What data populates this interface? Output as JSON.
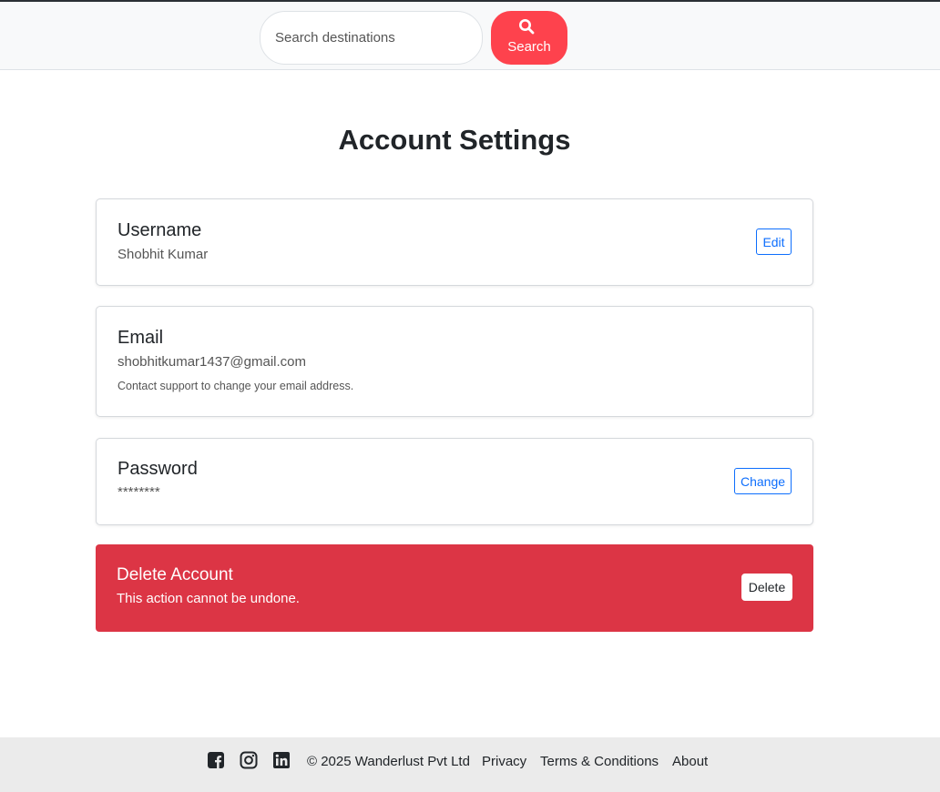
{
  "header": {
    "search_placeholder": "Search destinations",
    "search_label": "Search",
    "search_icon": "search-icon",
    "accent_color": "#fe424d"
  },
  "main": {
    "title": "Account Settings",
    "username": {
      "title": "Username",
      "value": "Shobhit Kumar",
      "button": "Edit"
    },
    "email": {
      "title": "Email",
      "value": "shobhitkumar1437@gmail.com",
      "note": "Contact support to change your email address."
    },
    "password": {
      "title": "Password",
      "value": "********",
      "button": "Change"
    },
    "delete": {
      "title": "Delete Account",
      "note": "This action cannot be undone.",
      "button": "Delete",
      "color": "#dc3545"
    }
  },
  "footer": {
    "icons": [
      "facebook-icon",
      "instagram-icon",
      "linkedin-icon"
    ],
    "copyright": "© 2025 Wanderlust Pvt Ltd",
    "links": [
      "Privacy",
      "Terms & Conditions",
      "About"
    ]
  }
}
